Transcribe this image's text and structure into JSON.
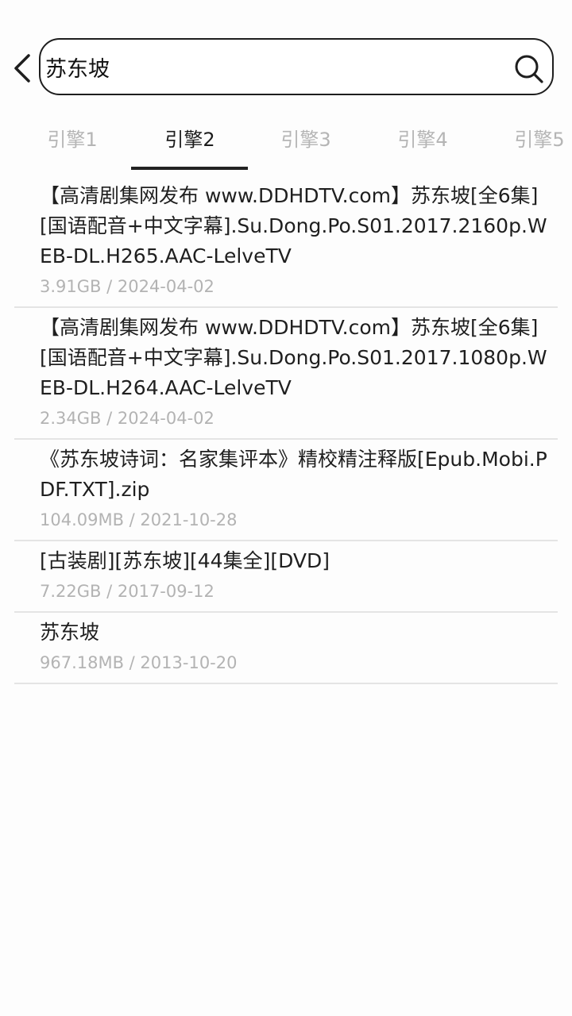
{
  "search": {
    "query": "苏东坡"
  },
  "tabs": [
    {
      "label": "引擎1"
    },
    {
      "label": "引擎2"
    },
    {
      "label": "引擎3"
    },
    {
      "label": "引擎4"
    },
    {
      "label": "引擎5"
    }
  ],
  "active_tab": "引擎2",
  "results": [
    {
      "title": "【高清剧集网发布 www.DDHDTV.com】苏东坡[全6集][国语配音+中文字幕].Su.Dong.Po.S01.2017.2160p.WEB-DL.H265.AAC-LelveTV",
      "meta": "3.91GB / 2024-04-02"
    },
    {
      "title": "【高清剧集网发布 www.DDHDTV.com】苏东坡[全6集][国语配音+中文字幕].Su.Dong.Po.S01.2017.1080p.WEB-DL.H264.AAC-LelveTV",
      "meta": "2.34GB / 2024-04-02"
    },
    {
      "title": "《苏东坡诗词：名家集评本》精校精注释版[Epub.Mobi.PDF.TXT].zip",
      "meta": "104.09MB / 2021-10-28"
    },
    {
      "title": "[古装剧][苏东坡][44集全][DVD]",
      "meta": "7.22GB / 2017-09-12"
    },
    {
      "title": "苏东坡",
      "meta": "967.18MB / 2013-10-20"
    }
  ],
  "icons": {
    "back": "chevron-left-icon",
    "search": "search-icon"
  },
  "colors": {
    "active_tab": "#1c1c1c",
    "inactive_tab": "#b5b5b5",
    "meta_text": "#b3b3b3",
    "divider": "#e4e4e4"
  }
}
